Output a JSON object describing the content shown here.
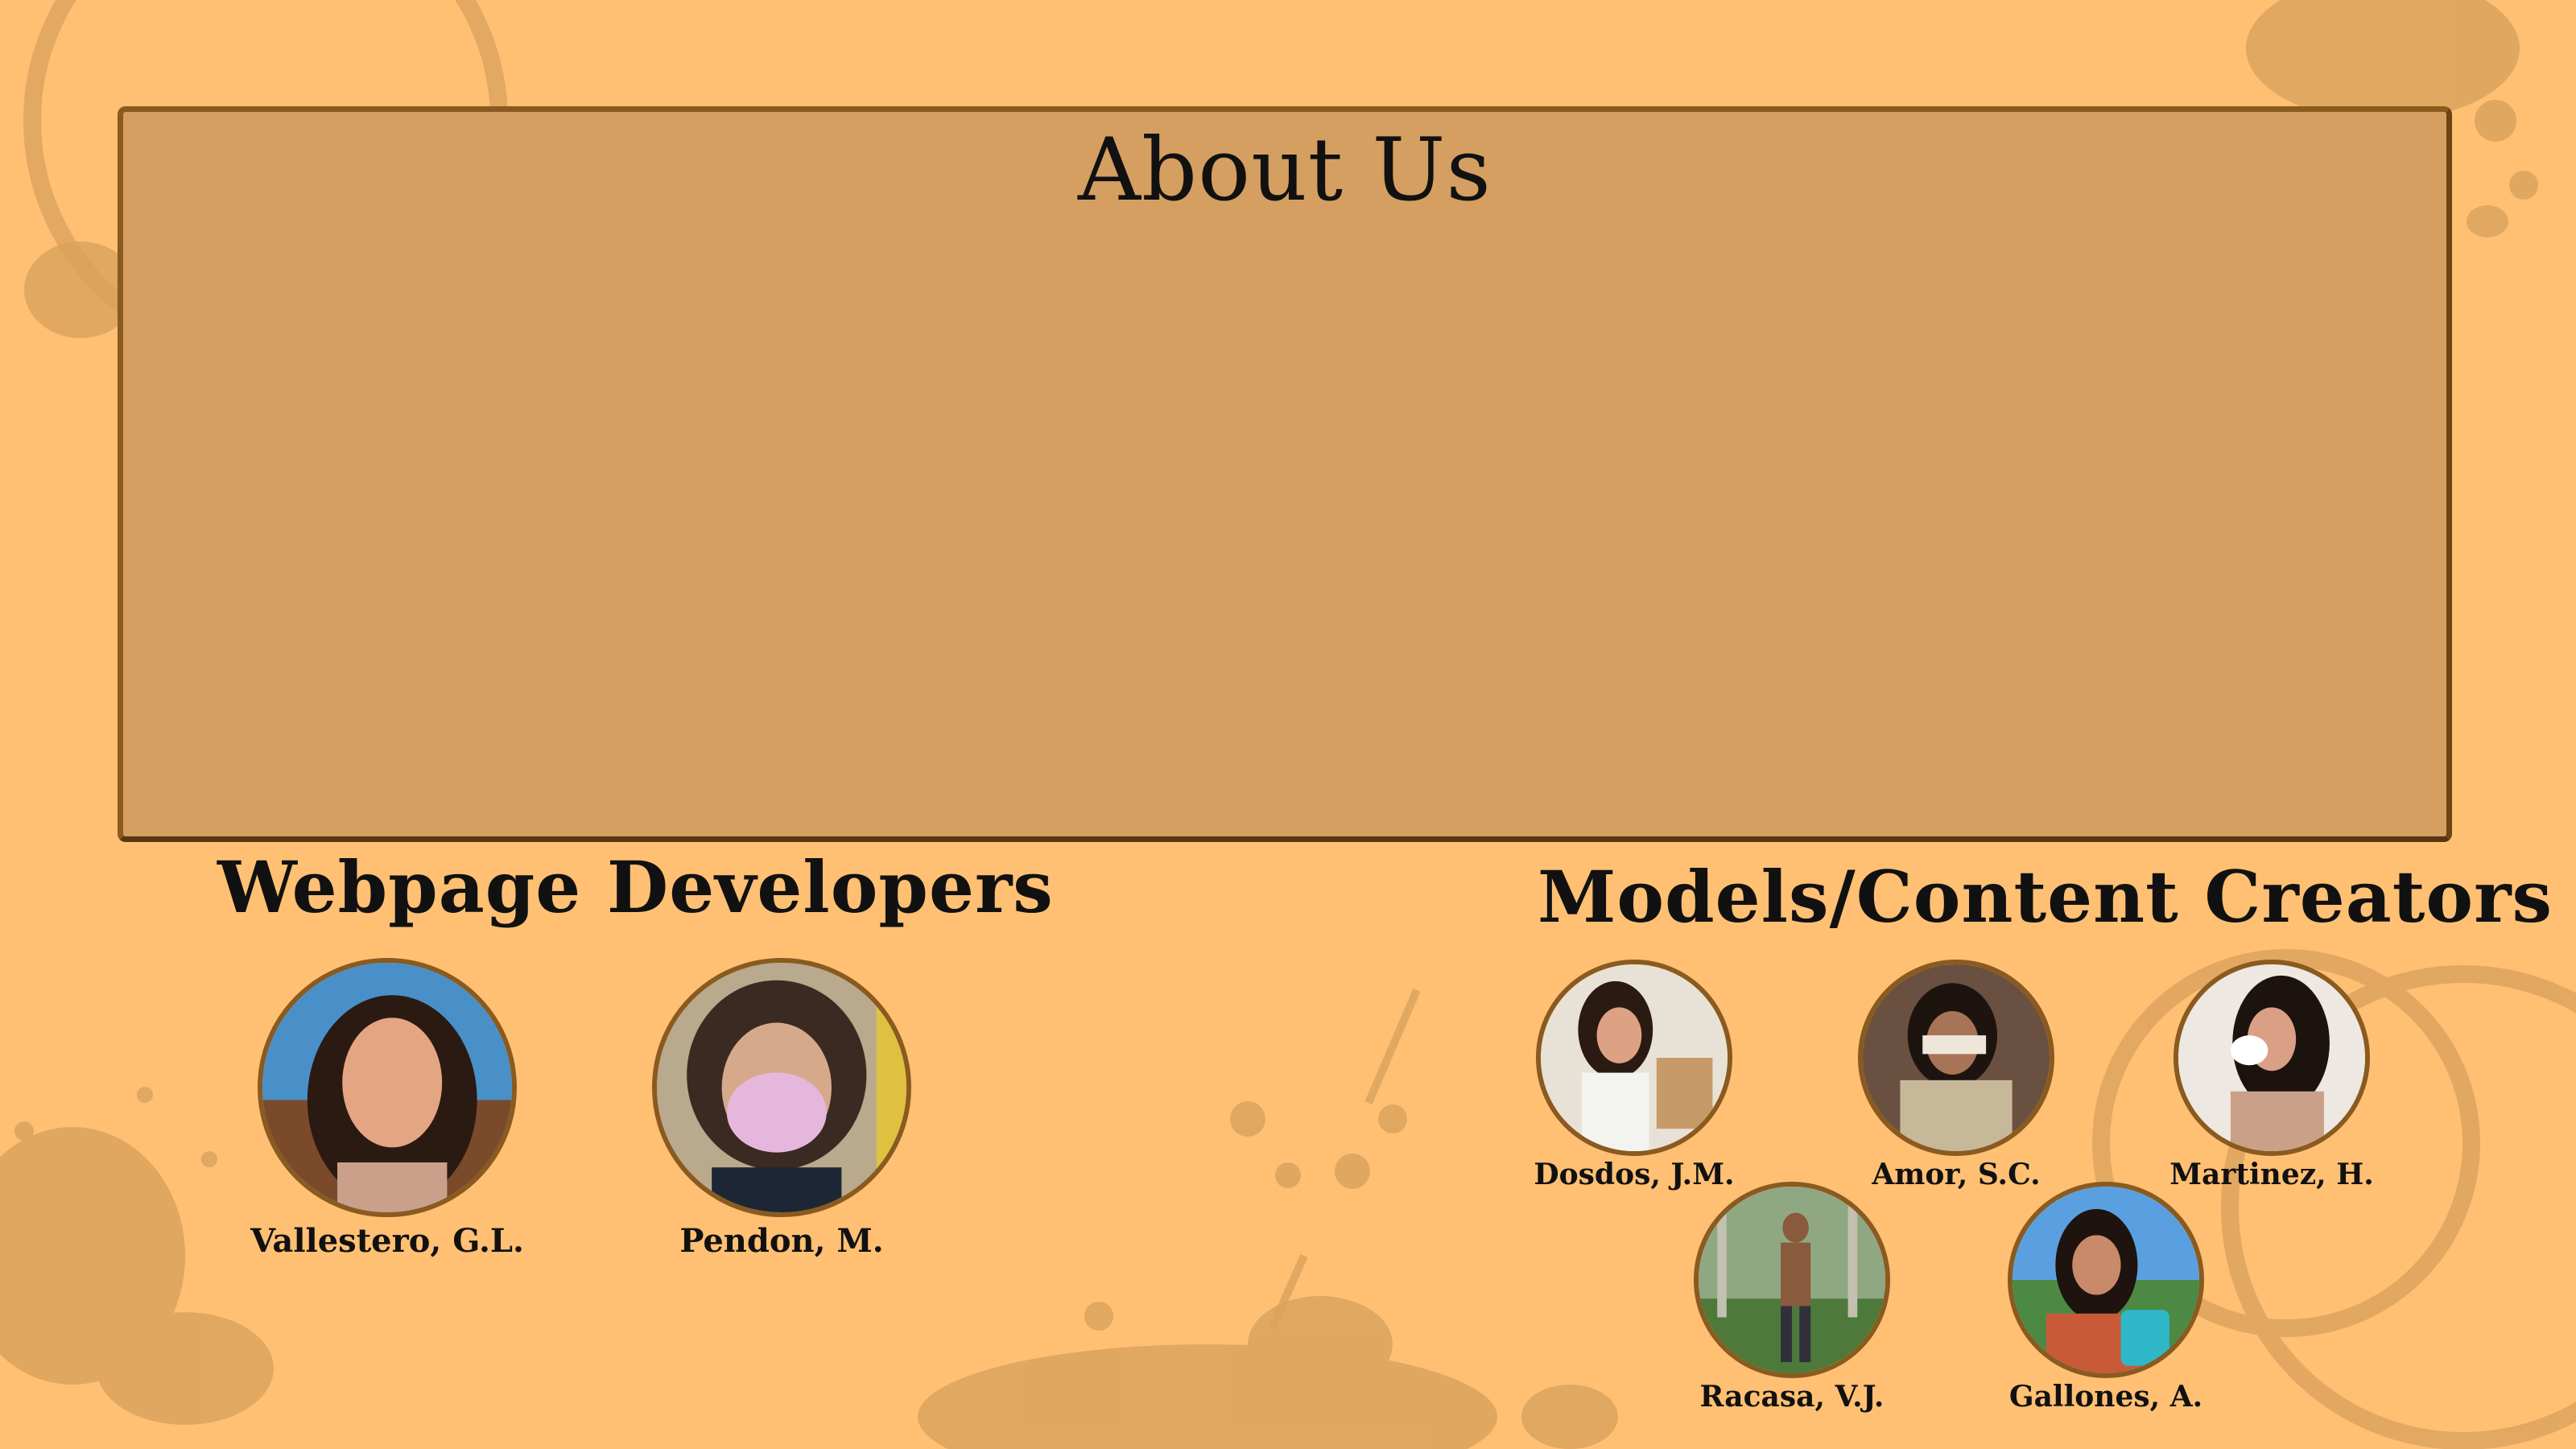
{
  "about": {
    "title": "About Us"
  },
  "developers": {
    "heading": "Webpage Developers",
    "members": [
      {
        "name": "Vallestero, G.L.",
        "photo": "portrait-photo"
      },
      {
        "name": "Pendon, M.",
        "photo": "portrait-photo"
      }
    ]
  },
  "models": {
    "heading": "Models/Content Creators",
    "members": [
      {
        "name": "Dosdos, J.M.",
        "photo": "portrait-photo"
      },
      {
        "name": "Amor, S.C.",
        "photo": "portrait-photo"
      },
      {
        "name": "Martinez, H.",
        "photo": "portrait-photo"
      },
      {
        "name": "Racasa, V.J.",
        "photo": "portrait-photo"
      },
      {
        "name": "Gallones, A.",
        "photo": "portrait-photo"
      }
    ]
  },
  "colors": {
    "background": "#ffc074",
    "panel": "#d59f61",
    "panel_border": "#8a5a1f",
    "stain": "#d9a15c"
  }
}
